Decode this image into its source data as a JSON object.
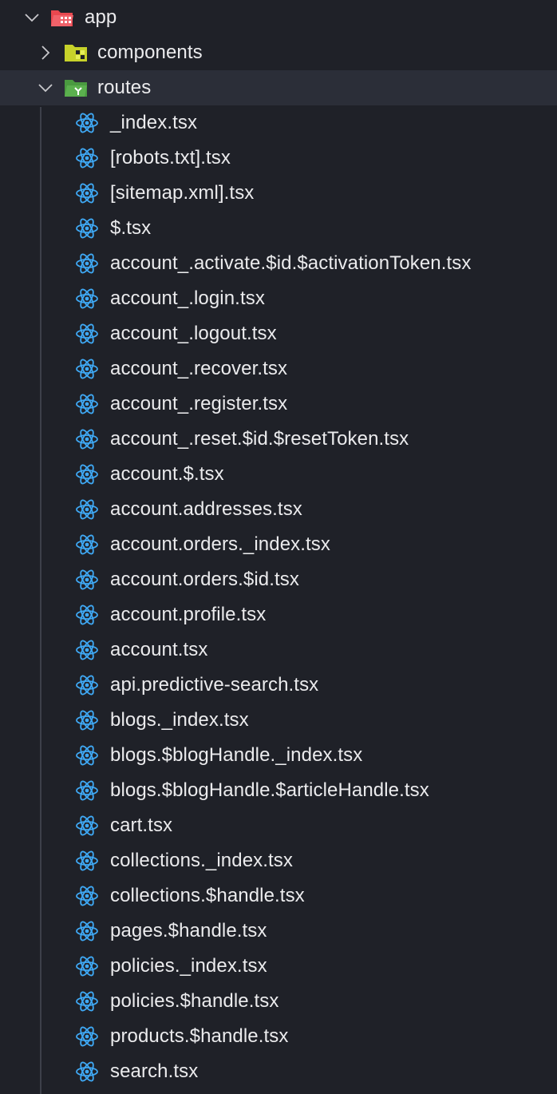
{
  "colors": {
    "background": "#1f2128",
    "selected_row": "#2b2e38",
    "react_icon": "#3fa9f5",
    "app_folder_icon": "#e8484f",
    "components_folder_icon": "#c7d22a",
    "routes_folder_icon": "#5bb04e",
    "text": "#ebebed"
  },
  "tree": {
    "root": {
      "label": "app",
      "icon": "folder-open-app-icon",
      "expanded": true
    },
    "folders": [
      {
        "label": "components",
        "icon": "folder-components-icon",
        "expanded": false
      },
      {
        "label": "routes",
        "icon": "folder-open-routes-icon",
        "expanded": true
      }
    ],
    "files": [
      "_index.tsx",
      "[robots.txt].tsx",
      "[sitemap.xml].tsx",
      "$.tsx",
      "account_.activate.$id.$activationToken.tsx",
      "account_.login.tsx",
      "account_.logout.tsx",
      "account_.recover.tsx",
      "account_.register.tsx",
      "account_.reset.$id.$resetToken.tsx",
      "account.$.tsx",
      "account.addresses.tsx",
      "account.orders._index.tsx",
      "account.orders.$id.tsx",
      "account.profile.tsx",
      "account.tsx",
      "api.predictive-search.tsx",
      "blogs._index.tsx",
      "blogs.$blogHandle._index.tsx",
      "blogs.$blogHandle.$articleHandle.tsx",
      "cart.tsx",
      "collections._index.tsx",
      "collections.$handle.tsx",
      "pages.$handle.tsx",
      "policies._index.tsx",
      "policies.$handle.tsx",
      "products.$handle.tsx",
      "search.tsx"
    ],
    "file_icon": "react-icon"
  }
}
